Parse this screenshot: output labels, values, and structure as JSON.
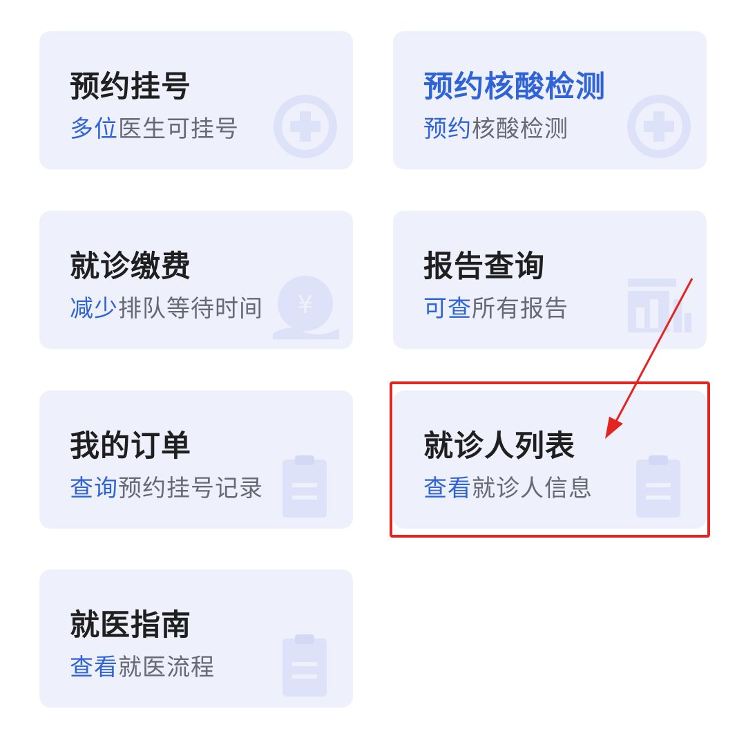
{
  "accent_color": "#2f63d6",
  "annotation_color": "#e32521",
  "cards": [
    {
      "title": "预约挂号",
      "sub_highlight": "多位",
      "sub_rest": "医生可挂号",
      "icon": "medical-cross-icon"
    },
    {
      "title": "预约核酸检测",
      "sub_highlight": "预约",
      "sub_rest": "核酸检测",
      "icon": "medical-cross-icon"
    },
    {
      "title": "就诊缴费",
      "sub_highlight": "减少",
      "sub_rest": "排队等待时间",
      "icon": "yen-coin-icon"
    },
    {
      "title": "报告查询",
      "sub_highlight": "可查",
      "sub_rest": "所有报告",
      "icon": "report-chart-icon"
    },
    {
      "title": "我的订单",
      "sub_highlight": "查询",
      "sub_rest": "预约挂号记录",
      "icon": "clipboard-icon"
    },
    {
      "title": "就诊人列表",
      "sub_highlight": "查看",
      "sub_rest": "就诊人信息",
      "icon": "clipboard-icon"
    },
    {
      "title": "就医指南",
      "sub_highlight": "查看",
      "sub_rest": "就医流程",
      "icon": "clipboard-icon"
    }
  ]
}
